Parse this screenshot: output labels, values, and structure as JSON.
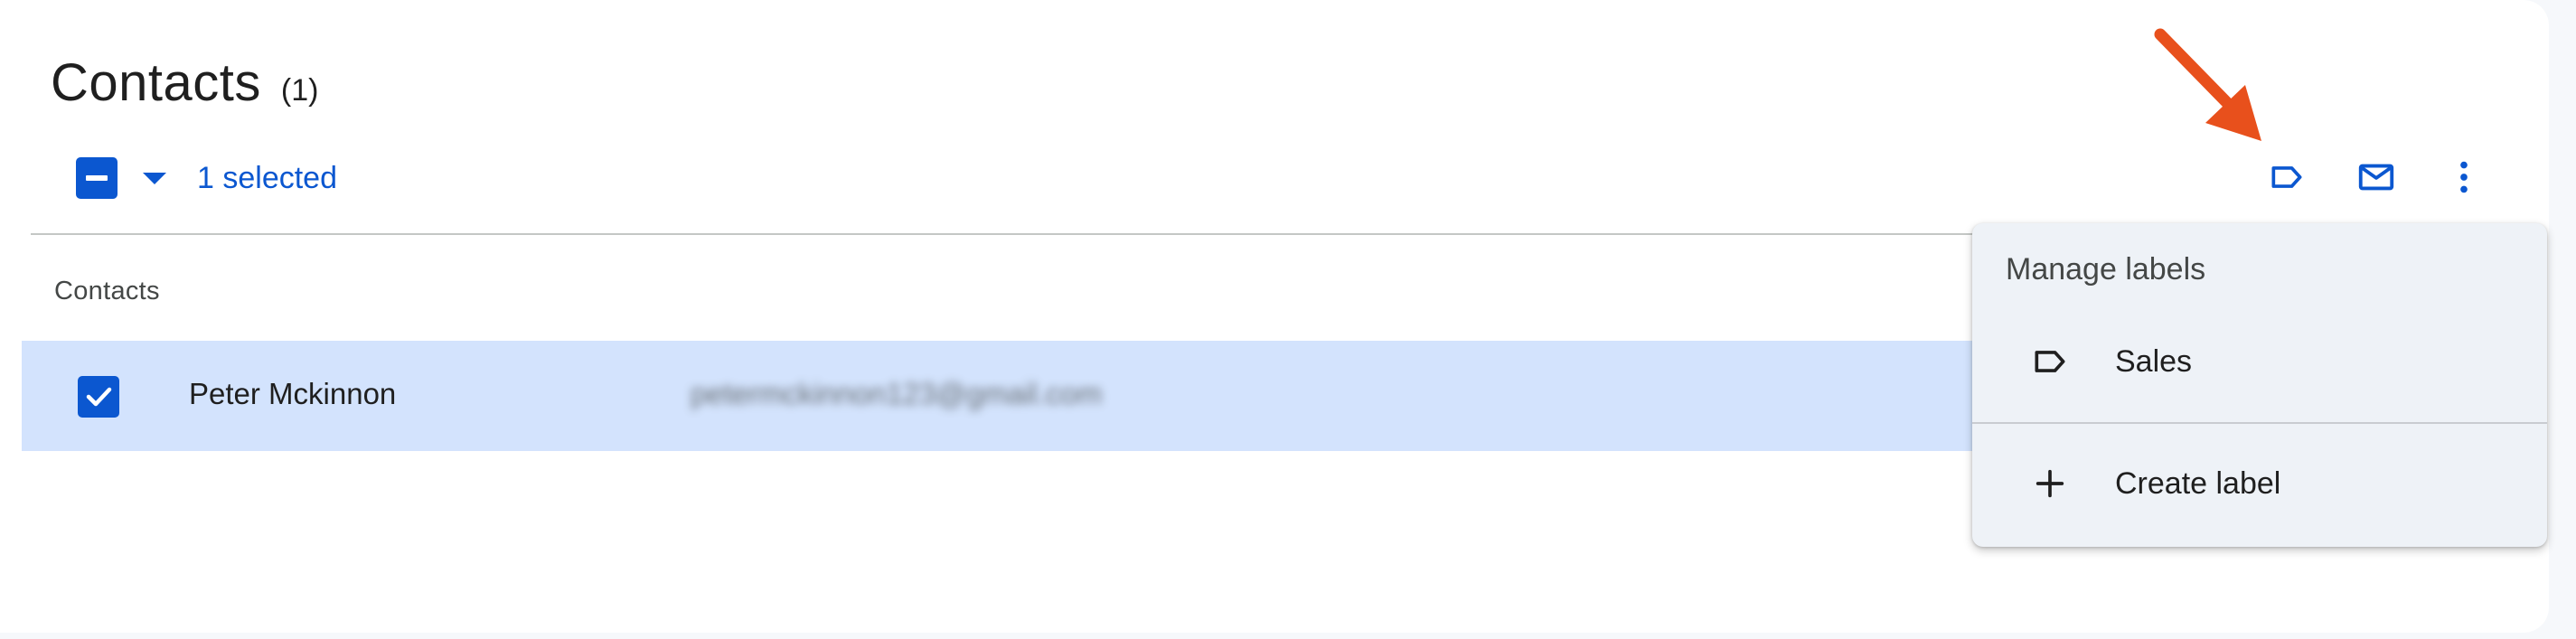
{
  "header": {
    "title": "Contacts",
    "count": "(1)"
  },
  "selection": {
    "selected_text": "1 selected"
  },
  "toolbar": {
    "icons": [
      "label-icon",
      "mail-icon",
      "more-vert-icon"
    ]
  },
  "list": {
    "section_label": "Contacts",
    "rows": [
      {
        "name": "Peter Mckinnon",
        "email": "petermckinnon123@gmail.com",
        "checked": true
      }
    ]
  },
  "label_menu": {
    "header": "Manage labels",
    "items": [
      {
        "label": "Sales",
        "icon": "label-icon"
      },
      {
        "label": "Create label",
        "icon": "plus-icon"
      }
    ]
  },
  "colors": {
    "accent": "#0b57d0",
    "selected_row": "#d3e3fd",
    "annotation_arrow": "#e8501c"
  }
}
